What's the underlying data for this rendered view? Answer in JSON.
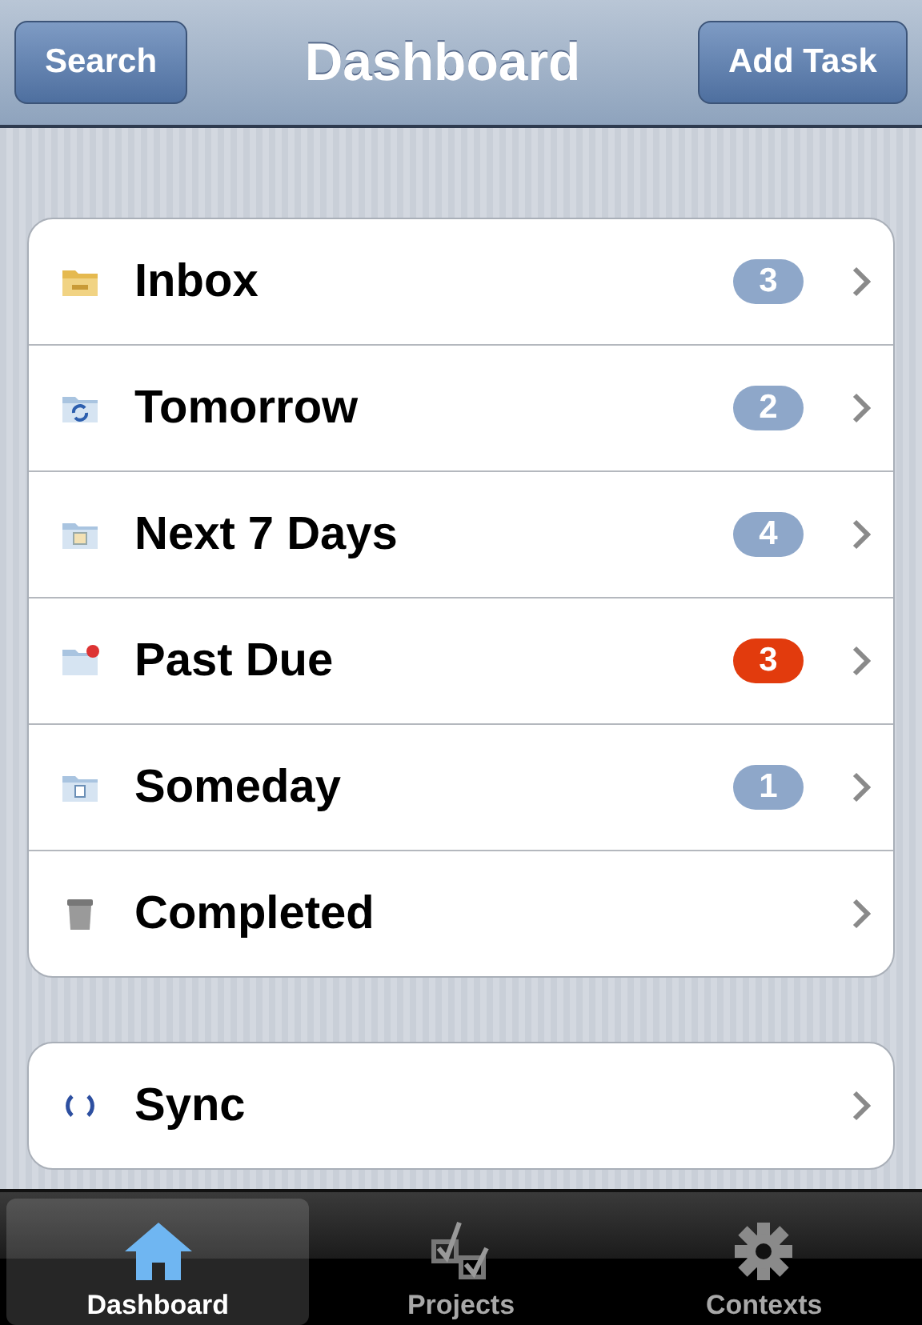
{
  "nav_bar": {
    "left_button": "Search",
    "title": "Dashboard",
    "right_button": "Add Task"
  },
  "groups": [
    {
      "items": [
        {
          "label": "Inbox",
          "kind": "inbox",
          "badge": "3",
          "urgent": false
        },
        {
          "label": "Tomorrow",
          "kind": "tomorrow",
          "badge": "2",
          "urgent": false
        },
        {
          "label": "Next 7 Days",
          "kind": "week",
          "badge": "4",
          "urgent": false
        },
        {
          "label": "Past Due",
          "kind": "pastdue",
          "badge": "3",
          "urgent": true
        },
        {
          "label": "Someday",
          "kind": "someday",
          "badge": "1",
          "urgent": false
        },
        {
          "label": "Completed",
          "kind": "trash"
        }
      ]
    },
    {
      "items": [
        {
          "label": "Sync",
          "kind": "sync"
        }
      ]
    }
  ],
  "tab_bar": [
    {
      "label": "Dashboard",
      "kind": "home",
      "selected": true
    },
    {
      "label": "Projects",
      "kind": "checks",
      "selected": false
    },
    {
      "label": "Contexts",
      "kind": "gear",
      "selected": false
    }
  ]
}
